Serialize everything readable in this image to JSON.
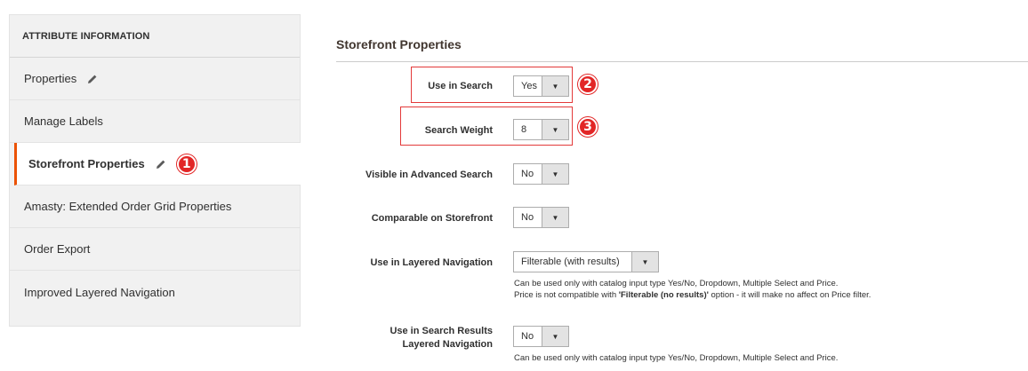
{
  "sidebar": {
    "header": "ATTRIBUTE INFORMATION",
    "items": [
      {
        "label": "Properties"
      },
      {
        "label": "Manage Labels"
      },
      {
        "label": "Storefront Properties"
      },
      {
        "label": "Amasty: Extended Order Grid Properties"
      },
      {
        "label": "Order Export"
      },
      {
        "label": "Improved Layered Navigation"
      }
    ]
  },
  "main": {
    "section_title": "Storefront Properties",
    "fields": [
      {
        "label": "Use in Search",
        "value": "Yes"
      },
      {
        "label": "Search Weight",
        "value": "8"
      },
      {
        "label": "Visible in Advanced Search",
        "value": "No"
      },
      {
        "label": "Comparable on Storefront",
        "value": "No"
      },
      {
        "label": "Use in Layered Navigation",
        "value": "Filterable (with results)",
        "note_line1": "Can be used only with catalog input type Yes/No, Dropdown, Multiple Select and Price.",
        "note_line2_pre": "Price is not compatible with ",
        "note_line2_bold": "'Filterable (no results)'",
        "note_line2_post": " option - it will make no affect on Price filter."
      },
      {
        "label_line1": "Use in Search Results",
        "label_line2": "Layered Navigation",
        "value": "No",
        "note_line1": "Can be used only with catalog input type Yes/No, Dropdown, Multiple Select and Price."
      }
    ]
  },
  "callouts": [
    "1",
    "2",
    "3"
  ],
  "colors": {
    "accent": "#eb5202",
    "callout": "#e22626",
    "highlight": "#e33a3a"
  },
  "icons": {
    "pencil": "pencil-icon",
    "dropdown": "chevron-down-icon"
  }
}
